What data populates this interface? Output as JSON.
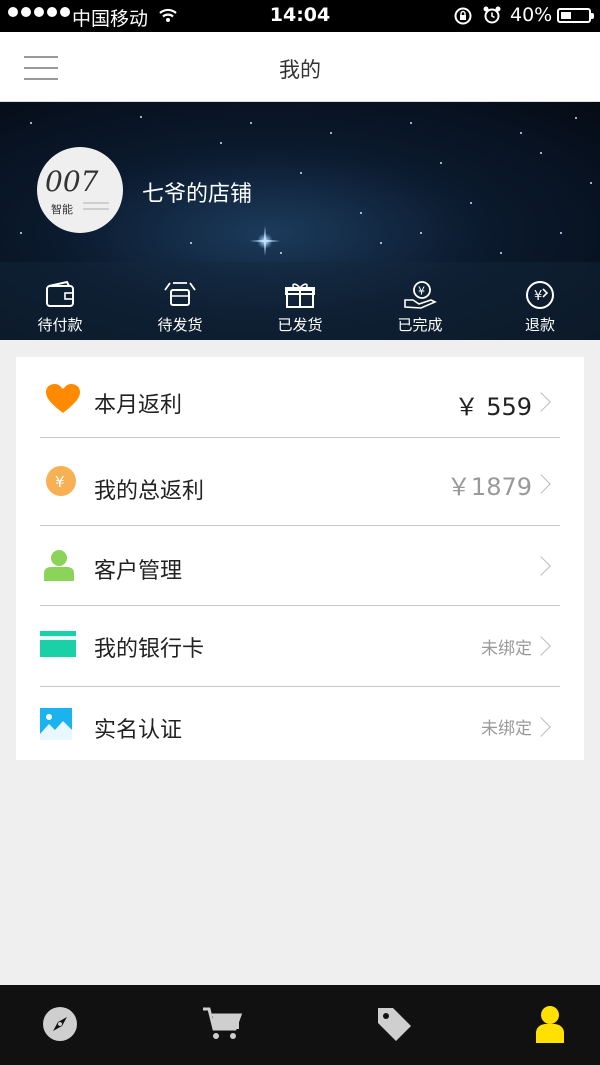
{
  "status_bar": {
    "carrier": "中国移动",
    "time": "14:04",
    "battery": "40%",
    "battery_level": 0.4
  },
  "nav": {
    "title": "我的"
  },
  "profile": {
    "shop_name": "七爷的店铺",
    "avatar_text": "007",
    "avatar_subtext": "智能"
  },
  "orders": [
    {
      "label": "待付款",
      "icon": "wallet-icon"
    },
    {
      "label": "待发货",
      "icon": "box-icon"
    },
    {
      "label": "已发货",
      "icon": "gift-icon"
    },
    {
      "label": "已完成",
      "icon": "hand-money-icon"
    },
    {
      "label": "退款",
      "icon": "refund-icon"
    }
  ],
  "menu": [
    {
      "label": "本月返利",
      "value": "￥ 559",
      "icon": "heart-icon",
      "color": "#ff8a00"
    },
    {
      "label": "我的总返利",
      "value": "￥1879",
      "icon": "coin-icon",
      "color": "#f7b053"
    },
    {
      "label": "客户管理",
      "value": "",
      "icon": "user-icon",
      "color": "#8cd35a"
    },
    {
      "label": "我的银行卡",
      "value": "未绑定",
      "icon": "card-icon",
      "color": "#1ad0a6"
    },
    {
      "label": "实名认证",
      "value": "未绑定",
      "icon": "image-icon",
      "color": "#1ab3f0"
    }
  ],
  "tabs": [
    {
      "icon": "compass-icon"
    },
    {
      "icon": "cart-icon"
    },
    {
      "icon": "tag-icon"
    },
    {
      "icon": "person-icon",
      "active_color": "#ffe000"
    }
  ]
}
